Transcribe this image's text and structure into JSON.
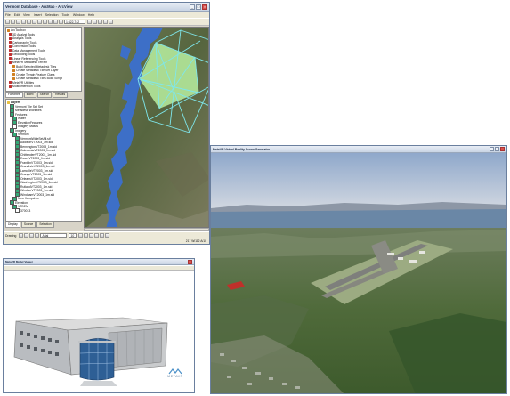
{
  "arcmap": {
    "title": "Vermont Database - ArcMap - ArcView",
    "menus": [
      "File",
      "Edit",
      "View",
      "Insert",
      "Selection",
      "Tools",
      "Window",
      "Help"
    ],
    "scale_value": "1:422,742",
    "drawing_label": "Drawing",
    "font_value": "Arial",
    "font_size_value": "10",
    "status_text": "217 W/112 A/10",
    "toolbox": {
      "title": "ArcToolbox",
      "items": [
        {
          "label": "3D Analyst Tools",
          "kind": "box"
        },
        {
          "label": "Analysis Tools",
          "kind": "box"
        },
        {
          "label": "Cartography Tools",
          "kind": "box"
        },
        {
          "label": "Conversion Tools",
          "kind": "box"
        },
        {
          "label": "Data Management Tools",
          "kind": "box"
        },
        {
          "label": "Geocoding Tools",
          "kind": "box"
        },
        {
          "label": "Linear Referencing Tools",
          "kind": "box"
        },
        {
          "label": "MetaVR Metadesk Terrain",
          "kind": "box"
        },
        {
          "label": "Build Selected Metadesk Tiles",
          "kind": "hammer"
        },
        {
          "label": "Create Metadesk Tile Set Layer",
          "kind": "hammer"
        },
        {
          "label": "Create Terrain Feature Class",
          "kind": "hammer"
        },
        {
          "label": "Create Metadesk Tiles Build Script",
          "kind": "hammer"
        },
        {
          "label": "MetaVR Utilities",
          "kind": "box"
        },
        {
          "label": "Multidimension Tools",
          "kind": "box"
        }
      ]
    },
    "toolbox_tabs": [
      "Favorites",
      "Index",
      "Search",
      "Results"
    ],
    "toc": {
      "title": "Layers",
      "items": [
        {
          "label": "Vermont Tile Set Set",
          "checked": true,
          "indent": 1
        },
        {
          "label": "Metadesk Workfiles",
          "checked": true,
          "indent": 1
        },
        {
          "label": "Features",
          "checked": true,
          "indent": 1
        },
        {
          "label": "Water",
          "checked": true,
          "indent": 2
        },
        {
          "label": "ElevationFeatures",
          "checked": true,
          "indent": 2
        },
        {
          "label": "Imagery Masks",
          "checked": false,
          "indent": 2
        },
        {
          "label": "Imagery",
          "checked": true,
          "indent": 1
        },
        {
          "label": "Vermont",
          "checked": true,
          "indent": 2
        },
        {
          "label": "VermontWideSetAll.sif",
          "checked": true,
          "indent": 3
        },
        {
          "label": "AddisonVT2003_1m.sid",
          "checked": true,
          "indent": 3
        },
        {
          "label": "BenningtonVT2003_1m.sid",
          "checked": true,
          "indent": 3
        },
        {
          "label": "CaledoniaVT2003_1m.sid",
          "checked": true,
          "indent": 3
        },
        {
          "label": "ChittendenVT2003_1m.sid",
          "checked": true,
          "indent": 3
        },
        {
          "label": "EssexVT2003_1m.sid",
          "checked": true,
          "indent": 3
        },
        {
          "label": "FranklinVT2003_1m.sid",
          "checked": true,
          "indent": 3
        },
        {
          "label": "GrandIsleVT2003_1m.sid",
          "checked": true,
          "indent": 3
        },
        {
          "label": "LamoilleVT2003_1m.sid",
          "checked": true,
          "indent": 3
        },
        {
          "label": "OrangeVT2003_1m.sid",
          "checked": true,
          "indent": 3
        },
        {
          "label": "OrleansVT2003_1m.sid",
          "checked": true,
          "indent": 3
        },
        {
          "label": "WashingtonVT2003_1m.sid",
          "checked": true,
          "indent": 3
        },
        {
          "label": "RutlandVT2003_1m.sid",
          "checked": true,
          "indent": 3
        },
        {
          "label": "WindsorVT2003_1m.sid",
          "checked": true,
          "indent": 3
        },
        {
          "label": "WindhamVT2003_1m.sid",
          "checked": true,
          "indent": 3
        },
        {
          "label": "New Hampshire",
          "checked": true,
          "indent": 2
        },
        {
          "label": "Elevation",
          "checked": true,
          "indent": 1
        },
        {
          "label": "VTDEM",
          "checked": true,
          "indent": 2
        },
        {
          "label": "370013",
          "checked": false,
          "indent": 3
        }
      ]
    },
    "toc_tabs": [
      "Display",
      "Source",
      "Selection"
    ]
  },
  "viewer3d": {
    "title": "MetaVR Virtual Reality Scene Generator",
    "scene": "aerial-airport-terrain"
  },
  "model_viewer": {
    "title": "MetaVR Model Viewer",
    "logo_text": "METAVR"
  },
  "colors": {
    "window_border": "#6a7f9e",
    "water": "#3d6fc7",
    "tile_fill": "#b8f0a0",
    "tile_outline": "#7fe7ec",
    "sky_top": "#8fa8cb",
    "sky_bottom": "#d9dde3"
  }
}
